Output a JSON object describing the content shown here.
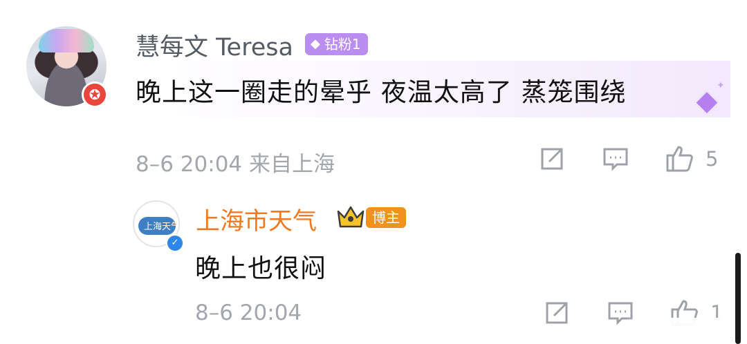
{
  "comment": {
    "author": "慧每文 Teresa",
    "fan_badge": "钻粉1",
    "text": "晚上这一圈走的晕乎 夜温太高了 蒸笼围绕",
    "meta": "8–6 20:04 来自上海",
    "like_count": "5"
  },
  "reply": {
    "author": "上海市天气",
    "author_badge": "博主",
    "avatar_text": "上海天气",
    "text": "晚上也很闷",
    "meta": "8–6 20:04",
    "like_count": "1"
  },
  "colors": {
    "author_orange": "#ef7a22",
    "fan_badge_purple": "#b98ef0",
    "meta_gray": "#a3a7ad"
  }
}
